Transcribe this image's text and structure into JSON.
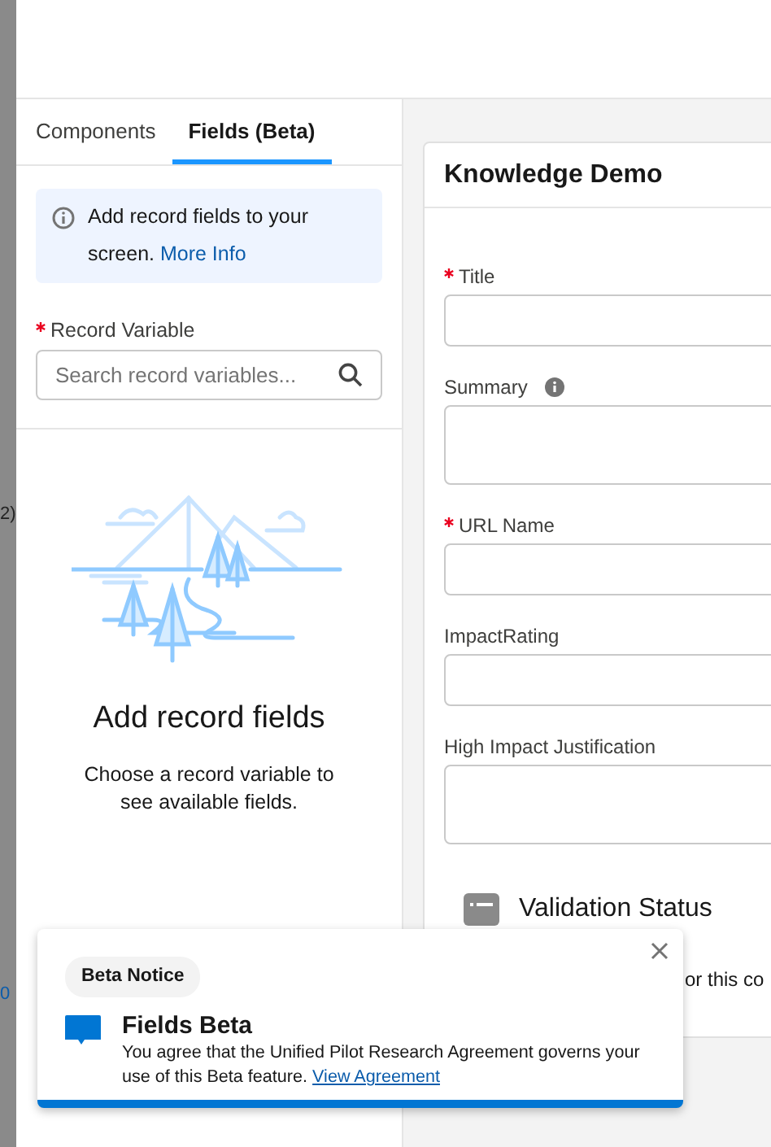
{
  "backdrop": {
    "texts": [
      "2)",
      "0"
    ]
  },
  "tabs": [
    {
      "label": "Components",
      "selected": false
    },
    {
      "label": "Fields (Beta)",
      "selected": true
    }
  ],
  "info": {
    "text": "Add record fields to your screen.",
    "link": "More Info"
  },
  "record_variable": {
    "label": "Record Variable",
    "required": true,
    "placeholder": "Search record variables..."
  },
  "empty_state": {
    "title": "Add record fields",
    "description": "Choose a record variable to see available fields."
  },
  "card": {
    "title": "Knowledge Demo",
    "fields": [
      {
        "label": "Title",
        "required": true,
        "info": false,
        "kind": "input"
      },
      {
        "label": "Summary",
        "required": false,
        "info": true,
        "kind": "textarea"
      },
      {
        "label": "URL Name",
        "required": true,
        "info": false,
        "kind": "input"
      },
      {
        "label": "ImpactRating",
        "required": false,
        "info": false,
        "kind": "input"
      },
      {
        "label": "High Impact Justification",
        "required": false,
        "info": false,
        "kind": "textarea"
      }
    ],
    "validation": {
      "title": "Validation Status",
      "text": "or this co"
    }
  },
  "notice": {
    "badge": "Beta Notice",
    "title": "Fields Beta",
    "text": "You agree that the Unified Pilot Research Agreement governs your use of this Beta feature.",
    "link": "View Agreement"
  }
}
